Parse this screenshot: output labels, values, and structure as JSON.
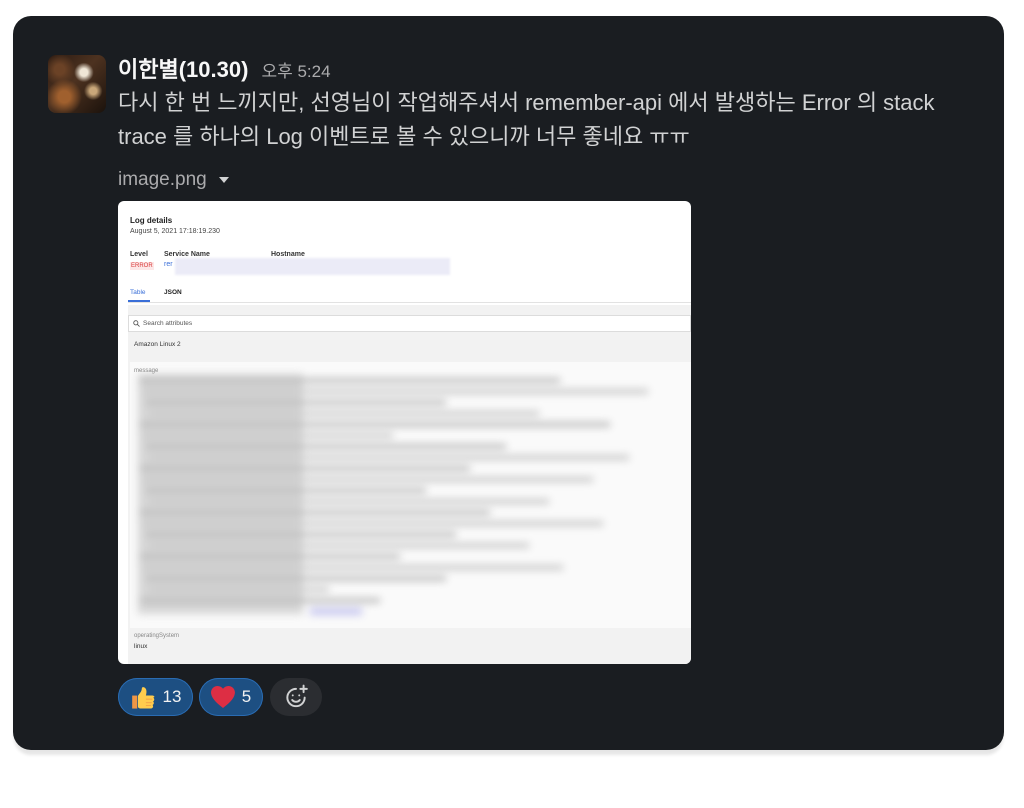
{
  "message": {
    "author": "이한별(10.30)",
    "timestamp": "오후 5:24",
    "text": "다시 한 번 느끼지만, 선영님이 작업해주셔서 remember-api 에서 발생하는 Error 의 stack trace 를 하나의 Log 이벤트로 볼 수 있으니까 너무 좋네요 ㅠㅠ",
    "attachment": {
      "filename": "image.png",
      "toggle_icon": "caret-down-icon",
      "screenshot": {
        "title": "Log details",
        "datetime": "August 5, 2021 17:18:19.230",
        "fields": [
          {
            "label": "Level",
            "value": "ERROR"
          },
          {
            "label": "Service Name",
            "value": "rer"
          },
          {
            "label": "Hostname"
          }
        ],
        "tabs": [
          {
            "label": "Table",
            "active": true
          },
          {
            "label": "JSON",
            "active": false
          }
        ],
        "search": {
          "placeholder": "Search attributes",
          "icon": "search-icon"
        },
        "attributes": [
          {
            "value": "Amazon Linux 2"
          },
          {
            "key": "message"
          },
          {
            "key": "operatingSystem",
            "value": "linux"
          }
        ]
      }
    },
    "reactions": [
      {
        "icon": "thumbs-up-icon",
        "count": 13,
        "reacted": true
      },
      {
        "icon": "heart-icon",
        "count": 5,
        "reacted": true
      }
    ],
    "add_reaction": {
      "icon": "add-reaction-icon"
    }
  },
  "colors": {
    "card_background": "#1a1d21",
    "message_text": "#d1d2d3",
    "muted_text": "#ababad",
    "reaction_background": "#1d4f82",
    "error_red": "#d83a3a",
    "link_blue": "#3a6fd8"
  }
}
